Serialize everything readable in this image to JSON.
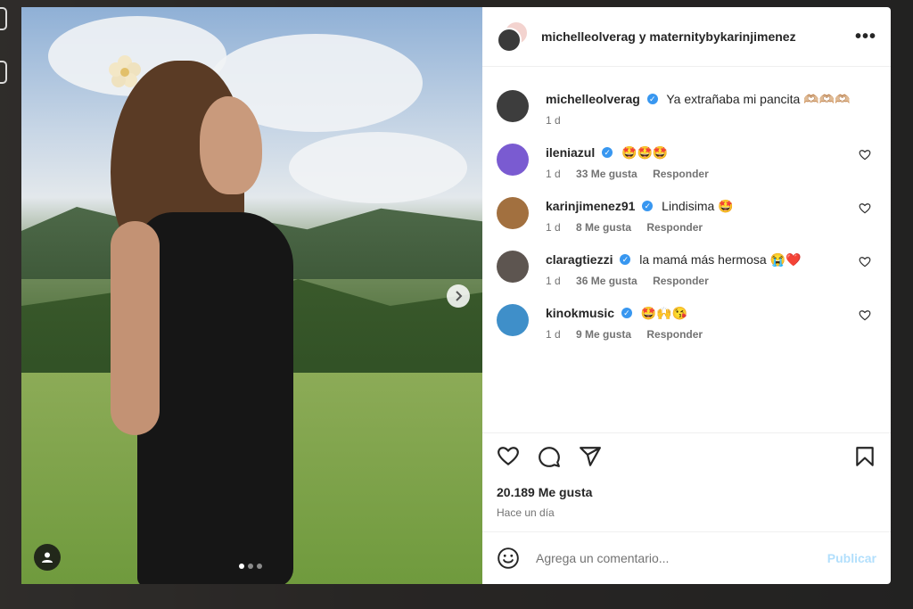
{
  "header": {
    "title": "michelleolverag y maternitybykarinjimenez",
    "more_label": "•••"
  },
  "caption": {
    "username": "michelleolverag",
    "text": "Ya extrañaba mi pancita 🫶🏼🫶🏼🫶🏼",
    "time": "1 d",
    "avatar_color": "#3d3d3d"
  },
  "comments": [
    {
      "username": "ileniazul",
      "text": "🤩🤩🤩",
      "time": "1 d",
      "likes": "33 Me gusta",
      "reply": "Responder",
      "avatar_color": "#7a5bd1"
    },
    {
      "username": "karinjimenez91",
      "text": "Lindisima 🤩",
      "time": "1 d",
      "likes": "8 Me gusta",
      "reply": "Responder",
      "avatar_color": "#a2703f"
    },
    {
      "username": "claragtiezzi",
      "text": "la mamá más hermosa 😭❤️",
      "time": "1 d",
      "likes": "36 Me gusta",
      "reply": "Responder",
      "avatar_color": "#5d5550"
    },
    {
      "username": "kinokmusic",
      "text": "🤩🙌😘",
      "time": "1 d",
      "likes": "9 Me gusta",
      "reply": "Responder",
      "avatar_color": "#3f8fc9"
    }
  ],
  "post": {
    "likes": "20.189 Me gusta",
    "time": "Hace un día"
  },
  "compose": {
    "placeholder": "Agrega un comentario...",
    "publish_label": "Publicar"
  },
  "carousel": {
    "dots": 3,
    "active_index": 0
  }
}
